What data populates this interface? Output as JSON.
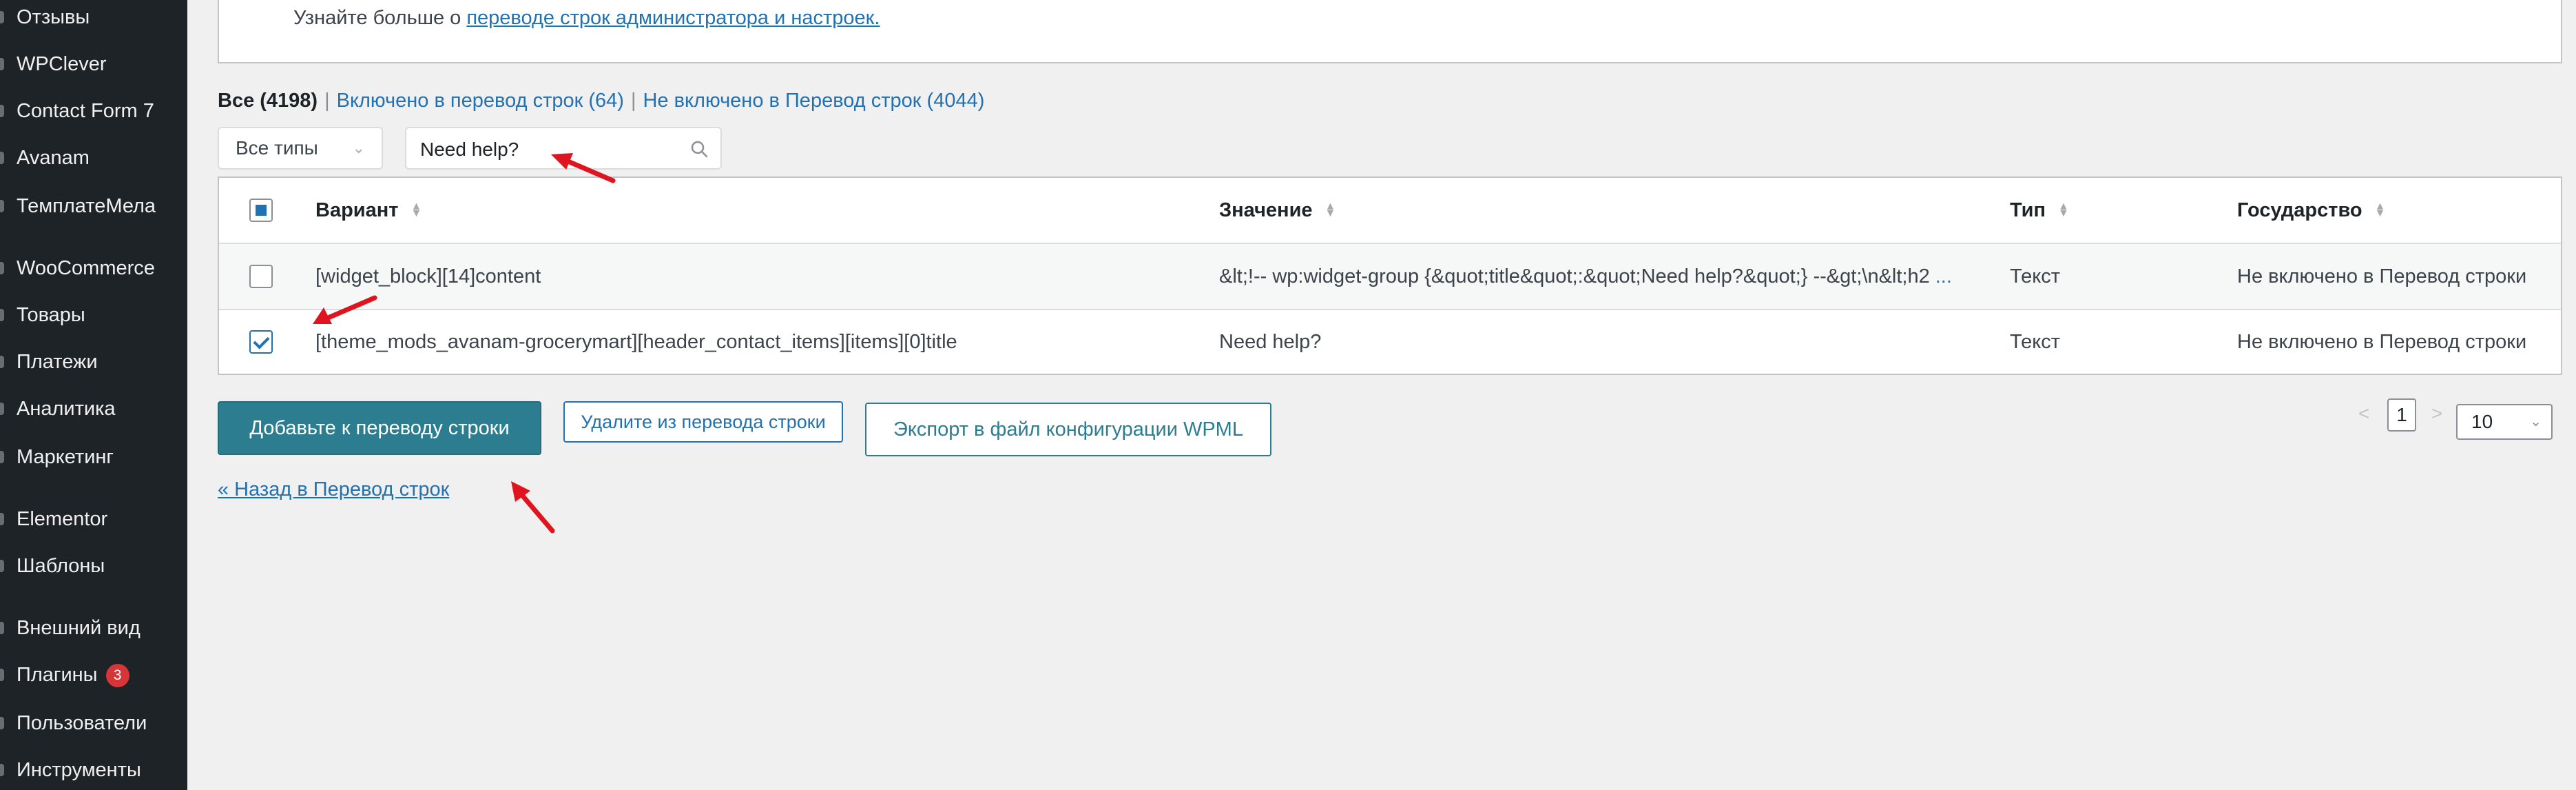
{
  "sidebar": {
    "items": [
      {
        "label": "Отзывы"
      },
      {
        "label": "WPClever"
      },
      {
        "label": "Contact Form 7"
      },
      {
        "label": "Avanam"
      },
      {
        "label": "ТемплатеМела"
      },
      {
        "label": "WooCommerce"
      },
      {
        "label": "Товары"
      },
      {
        "label": "Платежи"
      },
      {
        "label": "Аналитика"
      },
      {
        "label": "Маркетинг"
      },
      {
        "label": "Elementor"
      },
      {
        "label": "Шаблоны"
      },
      {
        "label": "Внешний вид"
      },
      {
        "label": "Плагины",
        "badge": "3"
      },
      {
        "label": "Пользователи"
      },
      {
        "label": "Инструменты"
      }
    ]
  },
  "notice": {
    "prefix": "Узнайте больше о ",
    "link": "переводе строк администратора и настроек."
  },
  "filters": {
    "all": "Все (4198)",
    "sep": "|",
    "included": "Включено в перевод строк (64)",
    "not_included": "Не включено в Перевод строк (4044)"
  },
  "type_select": {
    "value": "Все типы"
  },
  "search": {
    "value": "Need help?"
  },
  "table": {
    "headers": {
      "variant": "Вариант",
      "value": "Значение",
      "type": "Тип",
      "state": "Государство"
    },
    "rows": [
      {
        "checked": false,
        "variant": "[widget_block][14]content",
        "value": "&lt;!-- wp:widget-group {&quot;title&quot;:&quot;Need help?&quot;} --&gt;\\n&lt;h2",
        "ellipsis": "...",
        "type": "Текст",
        "state": "Не включено в Перевод строки"
      },
      {
        "checked": true,
        "variant": "[theme_mods_avanam-grocerymart][header_contact_items][items][0]title",
        "value": "Need help?",
        "ellipsis": "",
        "type": "Текст",
        "state": "Не включено в Перевод строки"
      }
    ]
  },
  "actions": {
    "add": "Добавьте к переводу строки",
    "remove": "Удалите из перевода строки",
    "export": "Экспорт в файл конфигурации WPML",
    "back": "« Назад в Перевод строк"
  },
  "pagination": {
    "prev": "<",
    "page": "1",
    "next": ">",
    "per_page": "10"
  },
  "colors": {
    "sidebar_bg": "#1d2327",
    "link": "#2271b1",
    "primary_button": "#2c7d90",
    "badge": "#d63638",
    "annotation_arrow": "#e0141e"
  }
}
